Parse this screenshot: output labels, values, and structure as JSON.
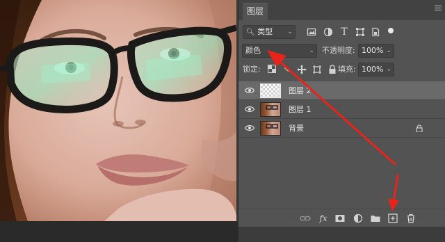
{
  "panel": {
    "tab_label": "图层",
    "filter": {
      "type_label": "类型"
    },
    "blend_mode": "颜色",
    "opacity_label": "不透明度:",
    "opacity_value": "100%",
    "lock_label": "锁定:",
    "fill_label": "填充:",
    "fill_value": "100%"
  },
  "layers": [
    {
      "name": "图层 2",
      "thumb": "transparent",
      "visible": true,
      "locked": false,
      "selected": true
    },
    {
      "name": "图层 1",
      "thumb": "photo",
      "visible": true,
      "locked": false,
      "selected": false
    },
    {
      "name": "背景",
      "thumb": "photo",
      "visible": true,
      "locked": true,
      "selected": false
    }
  ],
  "bottom_bar": {
    "icons": [
      "link-layers-icon",
      "fx-icon",
      "add-mask-icon",
      "adjustment-layer-icon",
      "new-group-icon",
      "new-layer-icon",
      "delete-layer-icon"
    ],
    "fx_text": "fx"
  },
  "annotation": {
    "arrow_color": "#e8231a"
  }
}
